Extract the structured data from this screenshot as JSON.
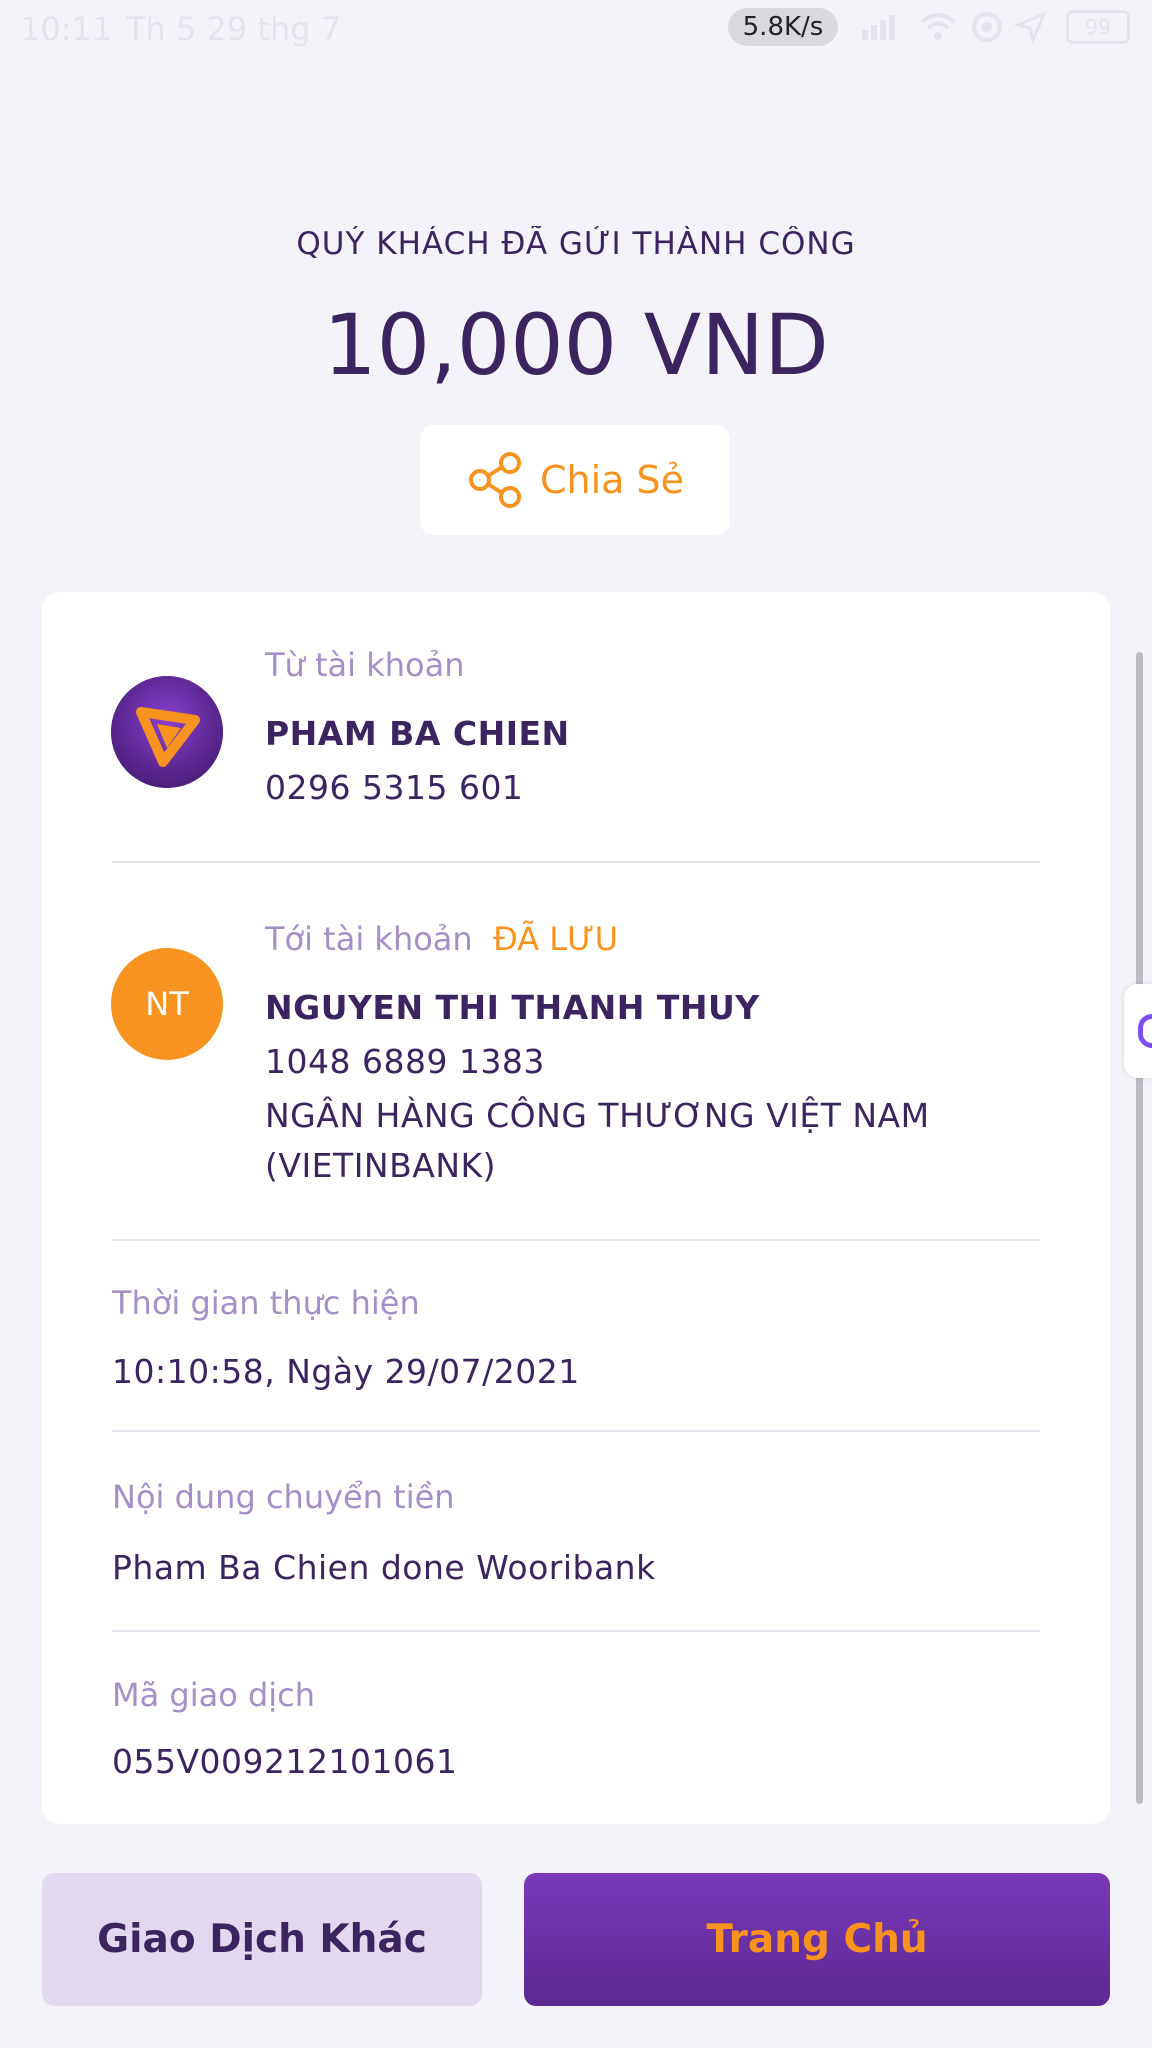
{
  "status_bar": {
    "time": "10:11",
    "date": "Th 5 29 thg 7",
    "network_speed": "5.8K/s",
    "battery": "99"
  },
  "header": {
    "status_text": "QUÝ KHÁCH ĐÃ GỬI THÀNH CÔNG",
    "amount": "10,000 VND",
    "share_label": "Chia Sẻ"
  },
  "from_account": {
    "label": "Từ tài khoản",
    "name": "PHAM BA CHIEN",
    "number": "0296 5315 601"
  },
  "to_account": {
    "label": "Tới tài khoản",
    "saved_tag": "ĐÃ LƯU",
    "avatar_initials": "NT",
    "name": "NGUYEN THI THANH THUY",
    "number": "1048 6889 1383",
    "bank_line1": "NGÂN HÀNG CÔNG THƯƠNG VIỆT NAM",
    "bank_line2": "(VIETINBANK)"
  },
  "details": {
    "time_label": "Thời gian thực hiện",
    "time_value": "10:10:58, Ngày 29/07/2021",
    "content_label": "Nội dung chuyển tiền",
    "content_value": "Pham Ba Chien done Wooribank",
    "code_label": "Mã giao dịch",
    "code_value": "055V009212101061"
  },
  "buttons": {
    "other_transaction": "Giao Dịch Khác",
    "home": "Trang Chủ"
  },
  "colors": {
    "primary_purple": "#5b2a92",
    "accent_orange": "#f7931e",
    "label_lilac": "#a48fc8",
    "background": "#f4f3fa"
  }
}
